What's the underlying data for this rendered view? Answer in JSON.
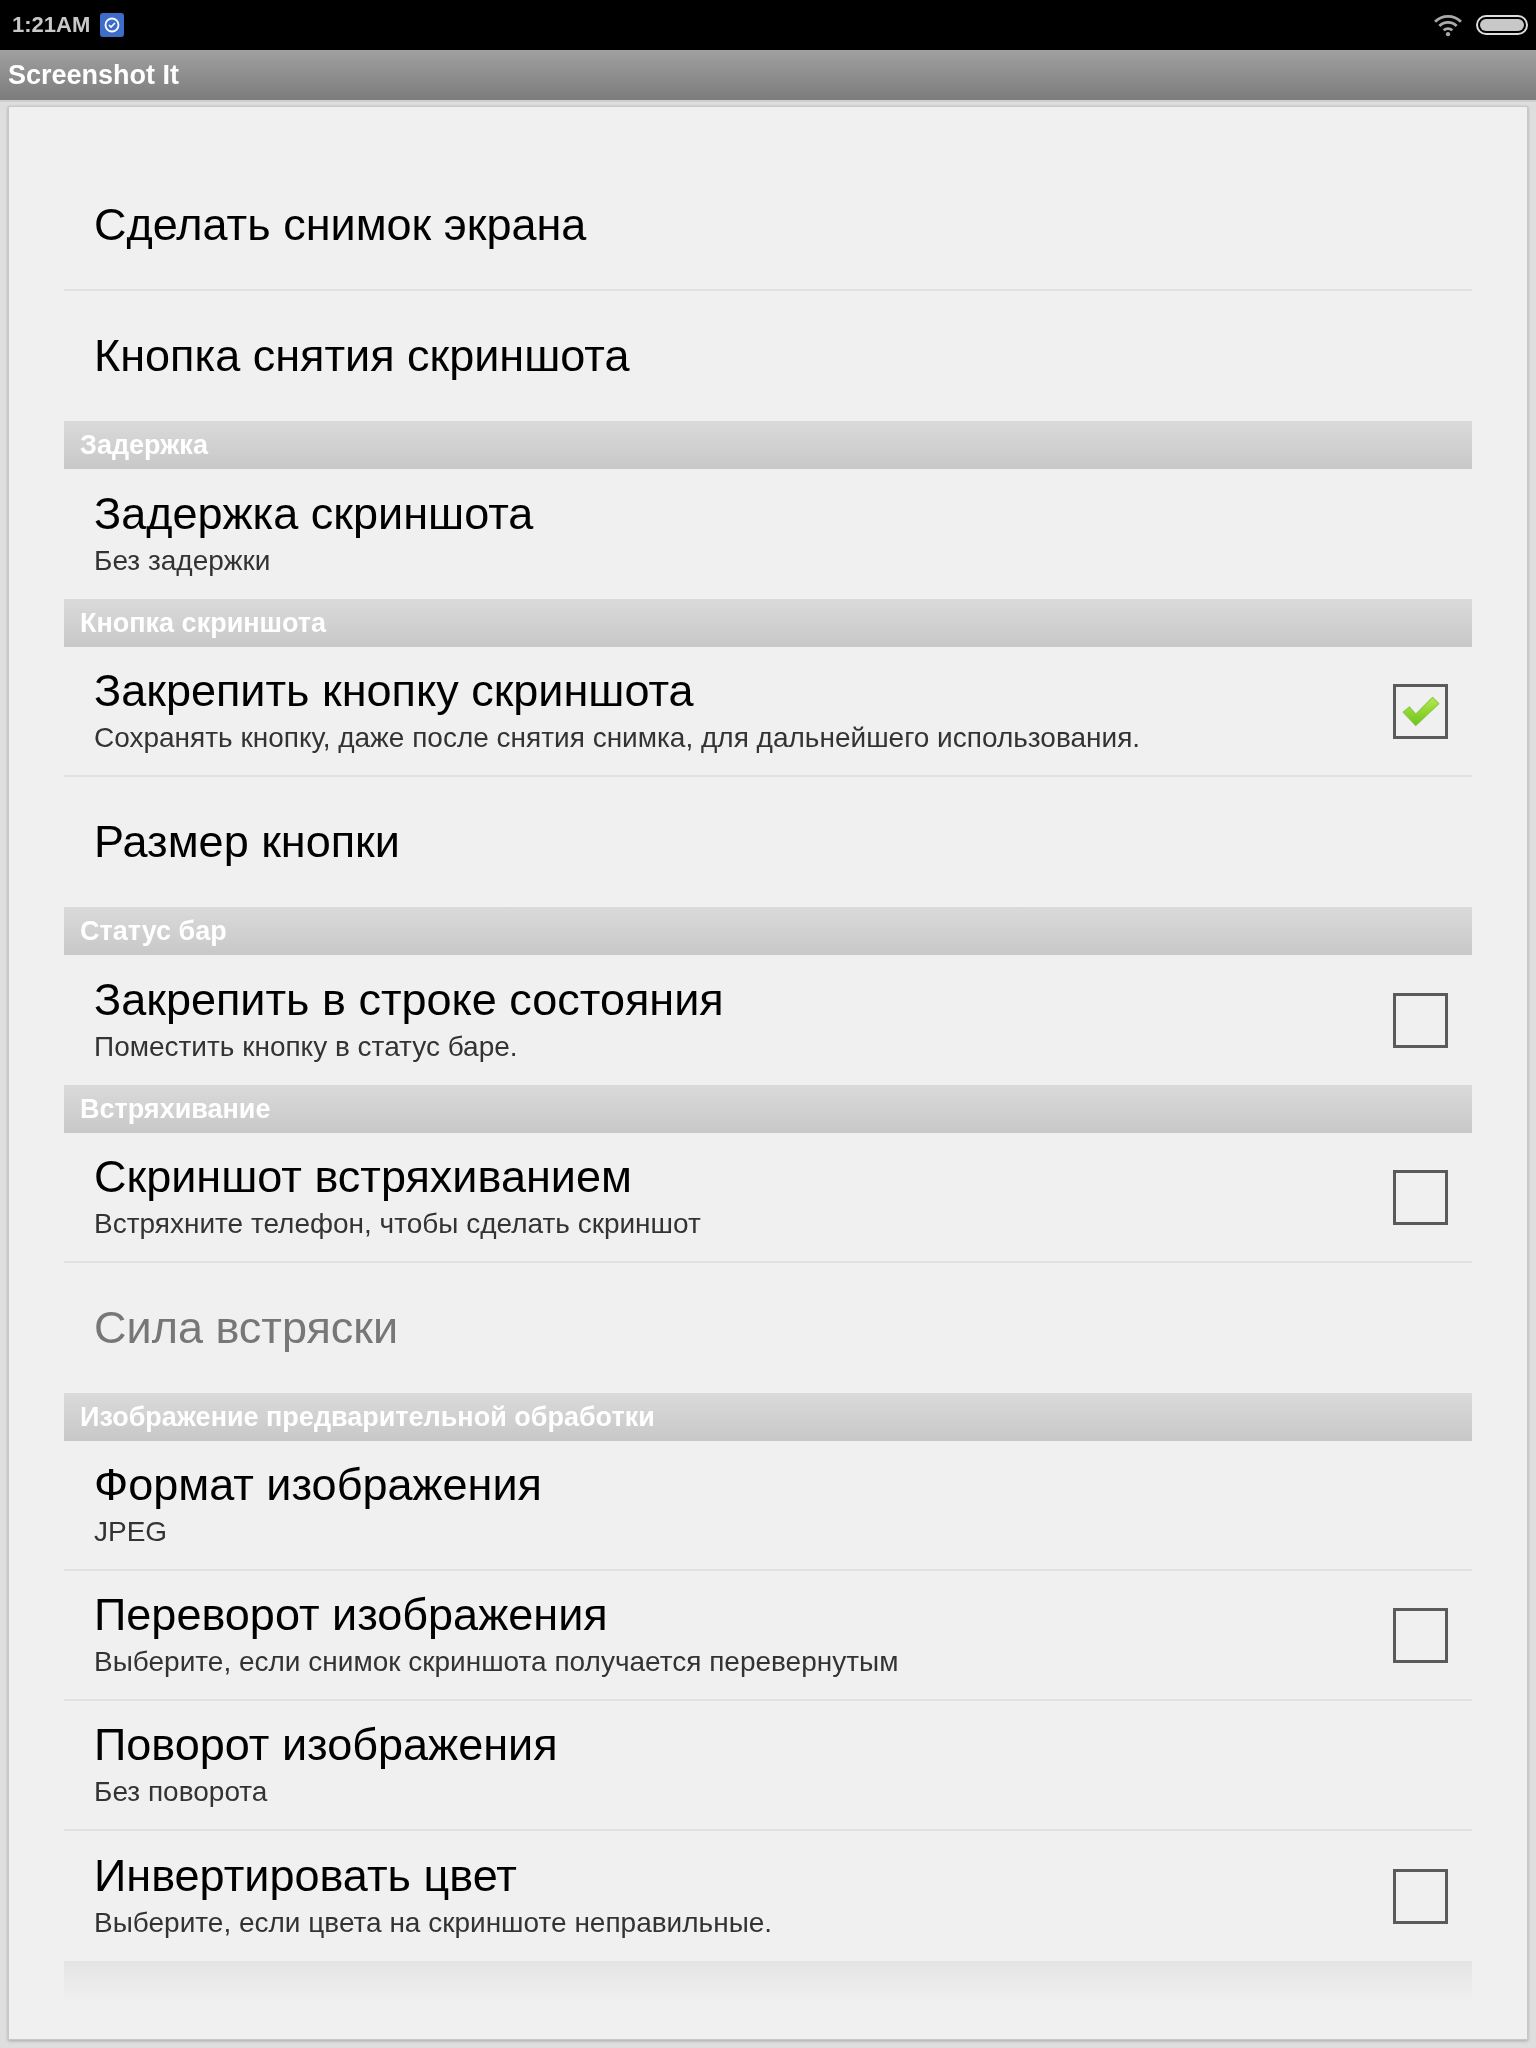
{
  "status_bar": {
    "time": "1:21AM"
  },
  "action_bar": {
    "title": "Screenshot It"
  },
  "preferences": [
    {
      "kind": "plain",
      "title": "Сделать снимок экрана",
      "disabled": false
    },
    {
      "kind": "plain",
      "title": "Кнопка снятия скриншота",
      "disabled": false
    },
    {
      "kind": "category",
      "title": "Задержка",
      "items": [
        {
          "kind": "plain",
          "title": "Задержка скриншота",
          "summary": "Без задержки",
          "disabled": false
        }
      ]
    },
    {
      "kind": "category",
      "title": "Кнопка скриншота",
      "items": [
        {
          "kind": "checkbox",
          "title": "Закрепить кнопку скриншота",
          "summary": "Сохранять кнопку, даже после снятия снимка, для дальнейшего использования.",
          "checked": true,
          "disabled": false
        },
        {
          "kind": "plain",
          "title": "Размер кнопки",
          "disabled": false
        }
      ]
    },
    {
      "kind": "category",
      "title": "Статус бар",
      "items": [
        {
          "kind": "checkbox",
          "title": "Закрепить в строке состояния",
          "summary": "Поместить кнопку в статус баре.",
          "checked": false,
          "disabled": false
        }
      ]
    },
    {
      "kind": "category",
      "title": "Встряхивание",
      "items": [
        {
          "kind": "checkbox",
          "title": "Скриншот встряхиванием",
          "summary": "Встряхните телефон, чтобы сделать скриншот",
          "checked": false,
          "disabled": false
        },
        {
          "kind": "plain",
          "title": "Сила встряски",
          "disabled": true
        }
      ]
    },
    {
      "kind": "category",
      "title": "Изображение предварительной обработки",
      "items": [
        {
          "kind": "plain",
          "title": "Формат изображения",
          "summary": "JPEG",
          "disabled": false
        },
        {
          "kind": "checkbox",
          "title": "Переворот изображения",
          "summary": "Выберите, если снимок скриншота получается перевернутым",
          "checked": false,
          "disabled": false
        },
        {
          "kind": "plain",
          "title": "Поворот изображения",
          "summary": "Без поворота",
          "disabled": false
        },
        {
          "kind": "checkbox",
          "title": "Инвертировать цвет",
          "summary": "Выберите, если цвета на скриншоте неправильные.",
          "checked": false,
          "disabled": false
        }
      ]
    },
    {
      "kind": "category_cut"
    }
  ]
}
